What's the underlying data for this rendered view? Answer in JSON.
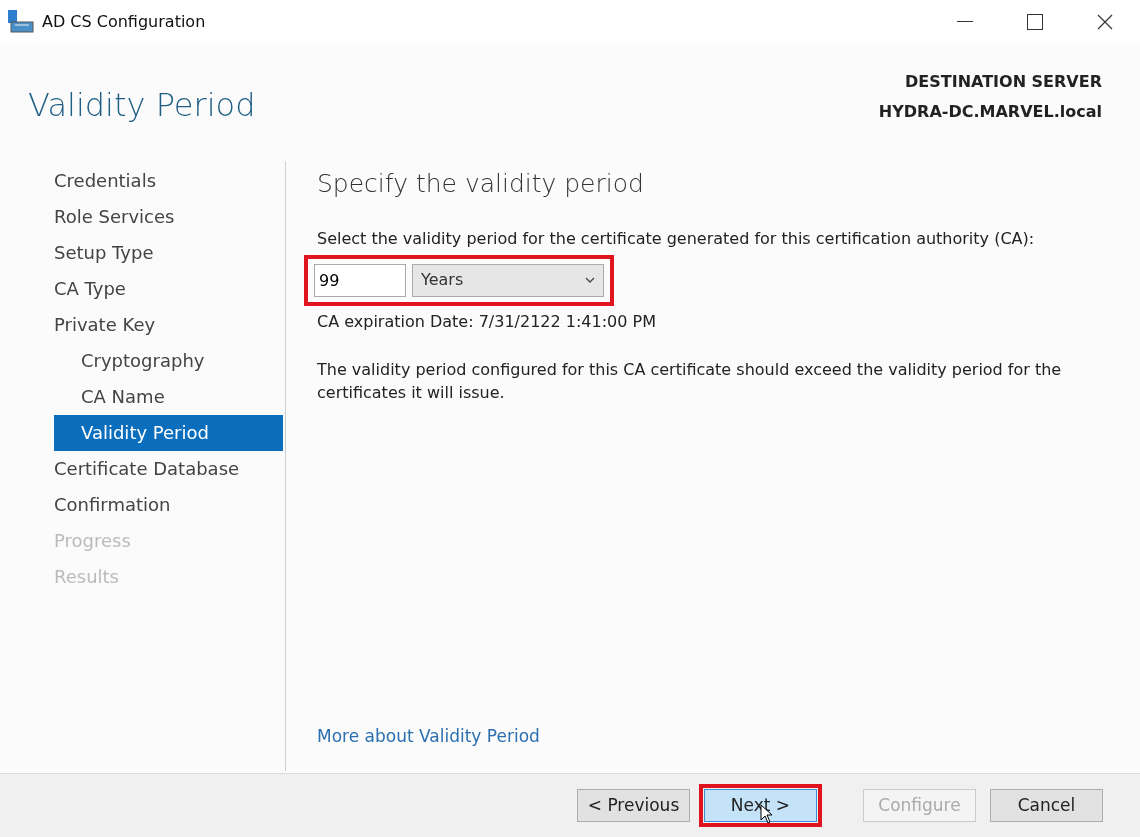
{
  "window": {
    "title": "AD CS Configuration"
  },
  "header": {
    "title": "Validity Period",
    "destination_label": "DESTINATION SERVER",
    "destination_server": "HYDRA-DC.MARVEL.local"
  },
  "sidebar": {
    "items": [
      {
        "label": "Credentials",
        "selected": false,
        "disabled": false
      },
      {
        "label": "Role Services",
        "selected": false,
        "disabled": false
      },
      {
        "label": "Setup Type",
        "selected": false,
        "disabled": false
      },
      {
        "label": "CA Type",
        "selected": false,
        "disabled": false
      },
      {
        "label": "Private Key",
        "selected": false,
        "disabled": false,
        "children": [
          {
            "label": "Cryptography",
            "selected": false,
            "disabled": false
          },
          {
            "label": "CA Name",
            "selected": false,
            "disabled": false
          },
          {
            "label": "Validity Period",
            "selected": true,
            "disabled": false
          }
        ]
      },
      {
        "label": "Certificate Database",
        "selected": false,
        "disabled": false
      },
      {
        "label": "Confirmation",
        "selected": false,
        "disabled": false
      },
      {
        "label": "Progress",
        "selected": false,
        "disabled": true
      },
      {
        "label": "Results",
        "selected": false,
        "disabled": true
      }
    ]
  },
  "content": {
    "heading": "Specify the validity period",
    "prompt": "Select the validity period for the certificate generated for this certification authority (CA):",
    "period_value": "99",
    "period_unit": "Years",
    "highlighted": true,
    "expiration": "CA expiration Date: 7/31/2122 1:41:00 PM",
    "note": "The validity period configured for this CA certificate should exceed the validity period for the certificates it will issue.",
    "help_link": "More about Validity Period"
  },
  "buttons": [
    {
      "label": "< Previous",
      "disabled": false,
      "focused": false,
      "highlighted": false
    },
    {
      "label": "Next >",
      "disabled": false,
      "focused": true,
      "highlighted": true
    },
    {
      "label": "Configure",
      "disabled": true,
      "focused": false,
      "highlighted": false
    },
    {
      "label": "Cancel",
      "disabled": false,
      "focused": false,
      "highlighted": false
    }
  ]
}
